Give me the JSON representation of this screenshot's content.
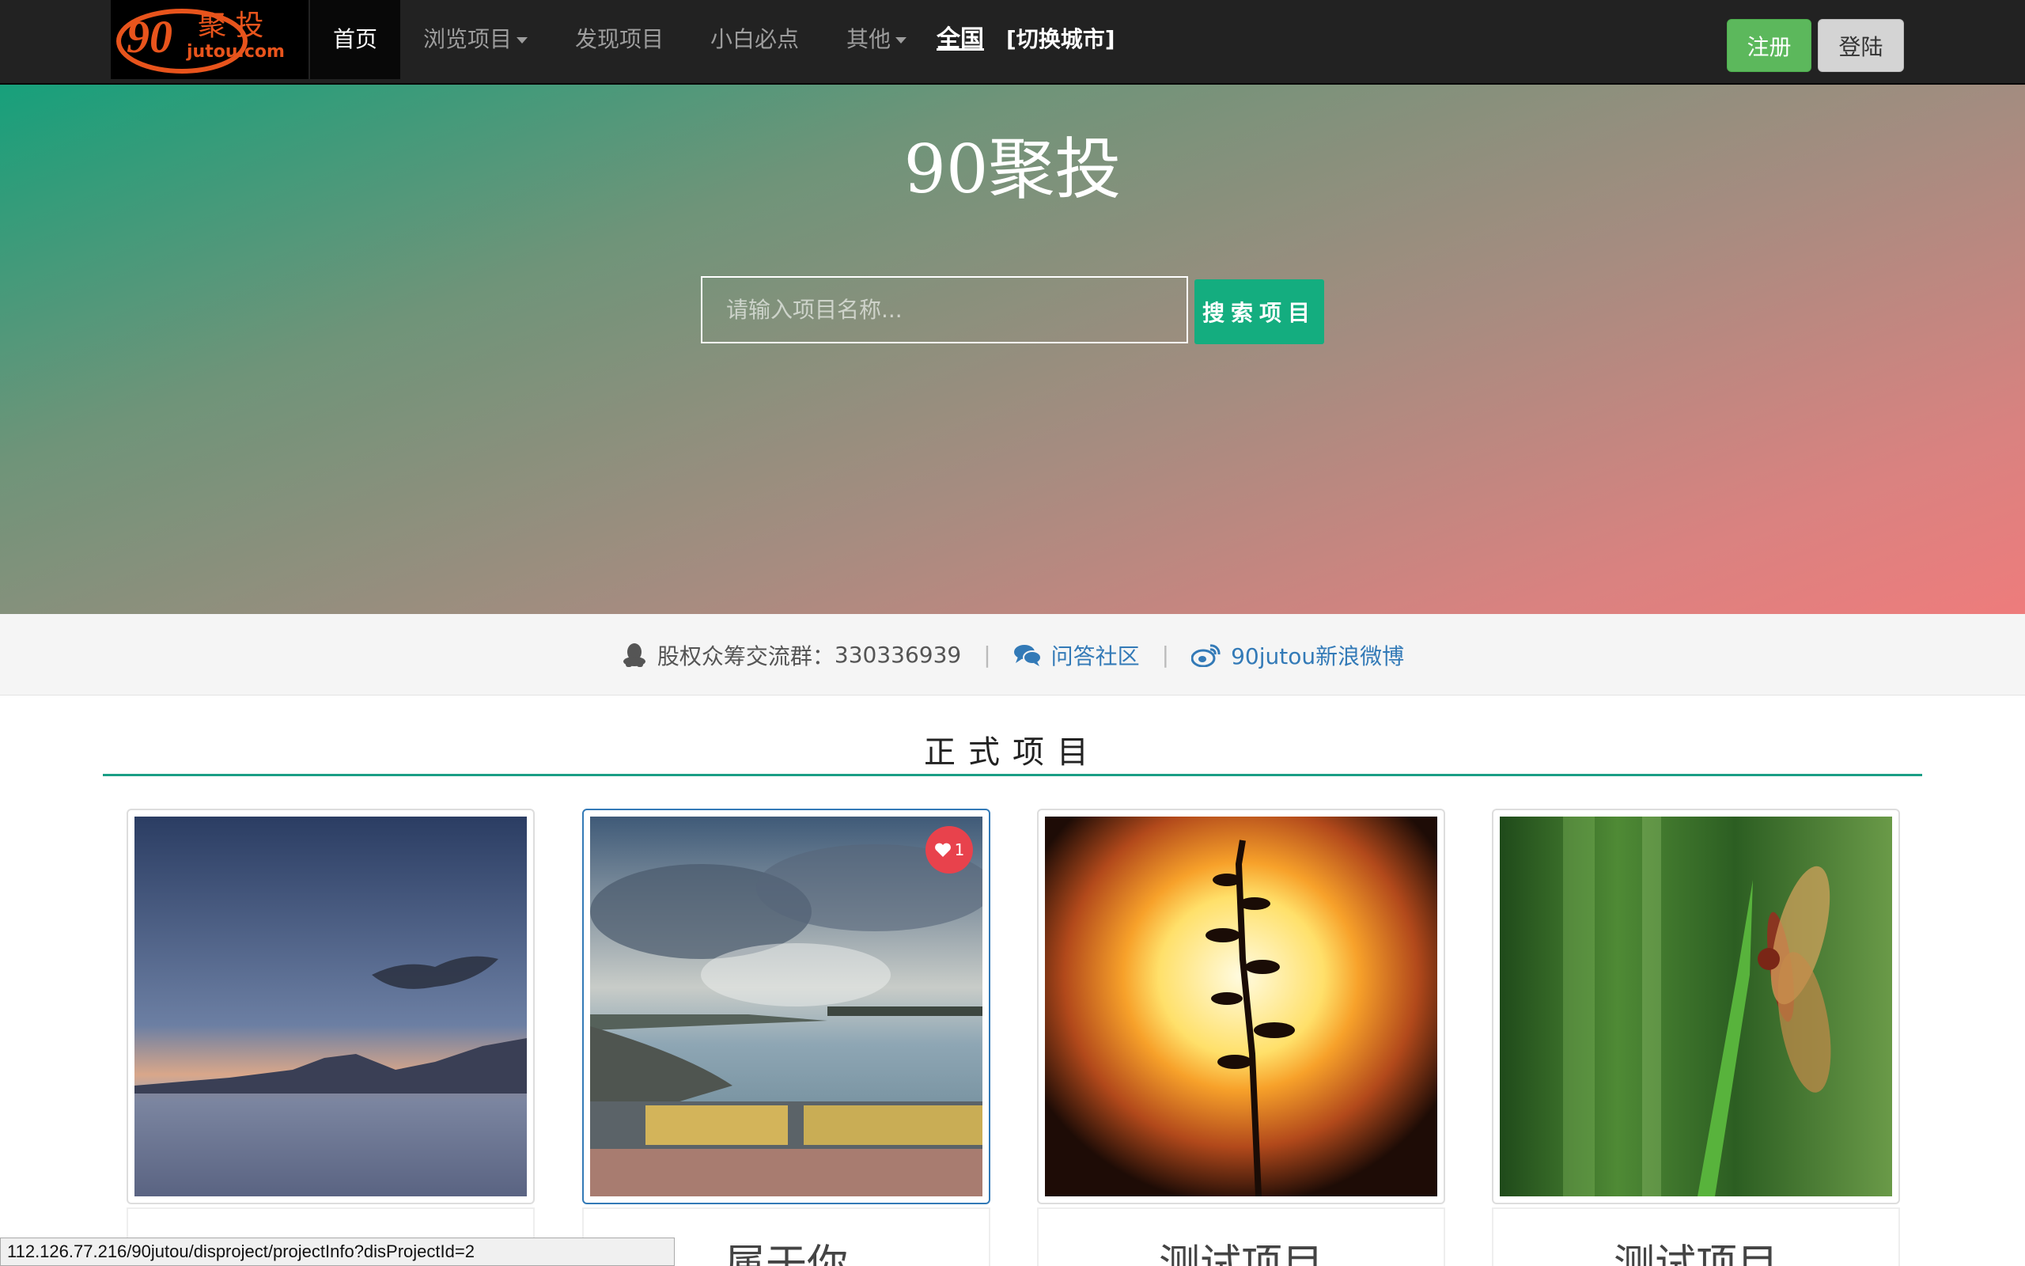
{
  "logo": {
    "number": "90",
    "chinese": "聚 投",
    "domain": "jutou.com"
  },
  "nav": {
    "home": "首页",
    "browse": "浏览项目",
    "discover": "发现项目",
    "beginner": "小白必点",
    "other": "其他",
    "city": "全国",
    "switch_city": "[切换城市]",
    "register": "注册",
    "login": "登陆"
  },
  "hero": {
    "title": "90聚投",
    "search_placeholder": "请输入项目名称...",
    "search_button": "搜索项目"
  },
  "infobar": {
    "qq_label": "股权众筹交流群：",
    "qq_number": "330336939",
    "sep1": "|",
    "community": "问答社区",
    "sep2": "|",
    "weibo": "90jutou新浪微博"
  },
  "section": {
    "title": "正式项目"
  },
  "cards": [
    {
      "title": "",
      "image": "lake-dusk"
    },
    {
      "title": "属于你",
      "image": "pier-clouds",
      "likes": "1"
    },
    {
      "title": "测试项目",
      "image": "sunset-plant"
    },
    {
      "title": "测试项目",
      "image": "dragonfly"
    }
  ],
  "status_url": "112.126.77.216/90jutou/disproject/projectInfo?disProjectId=2",
  "colors": {
    "accent": "#14ad7f",
    "register": "#5cb85c",
    "navbar": "#222222",
    "badge": "#e8424c"
  }
}
